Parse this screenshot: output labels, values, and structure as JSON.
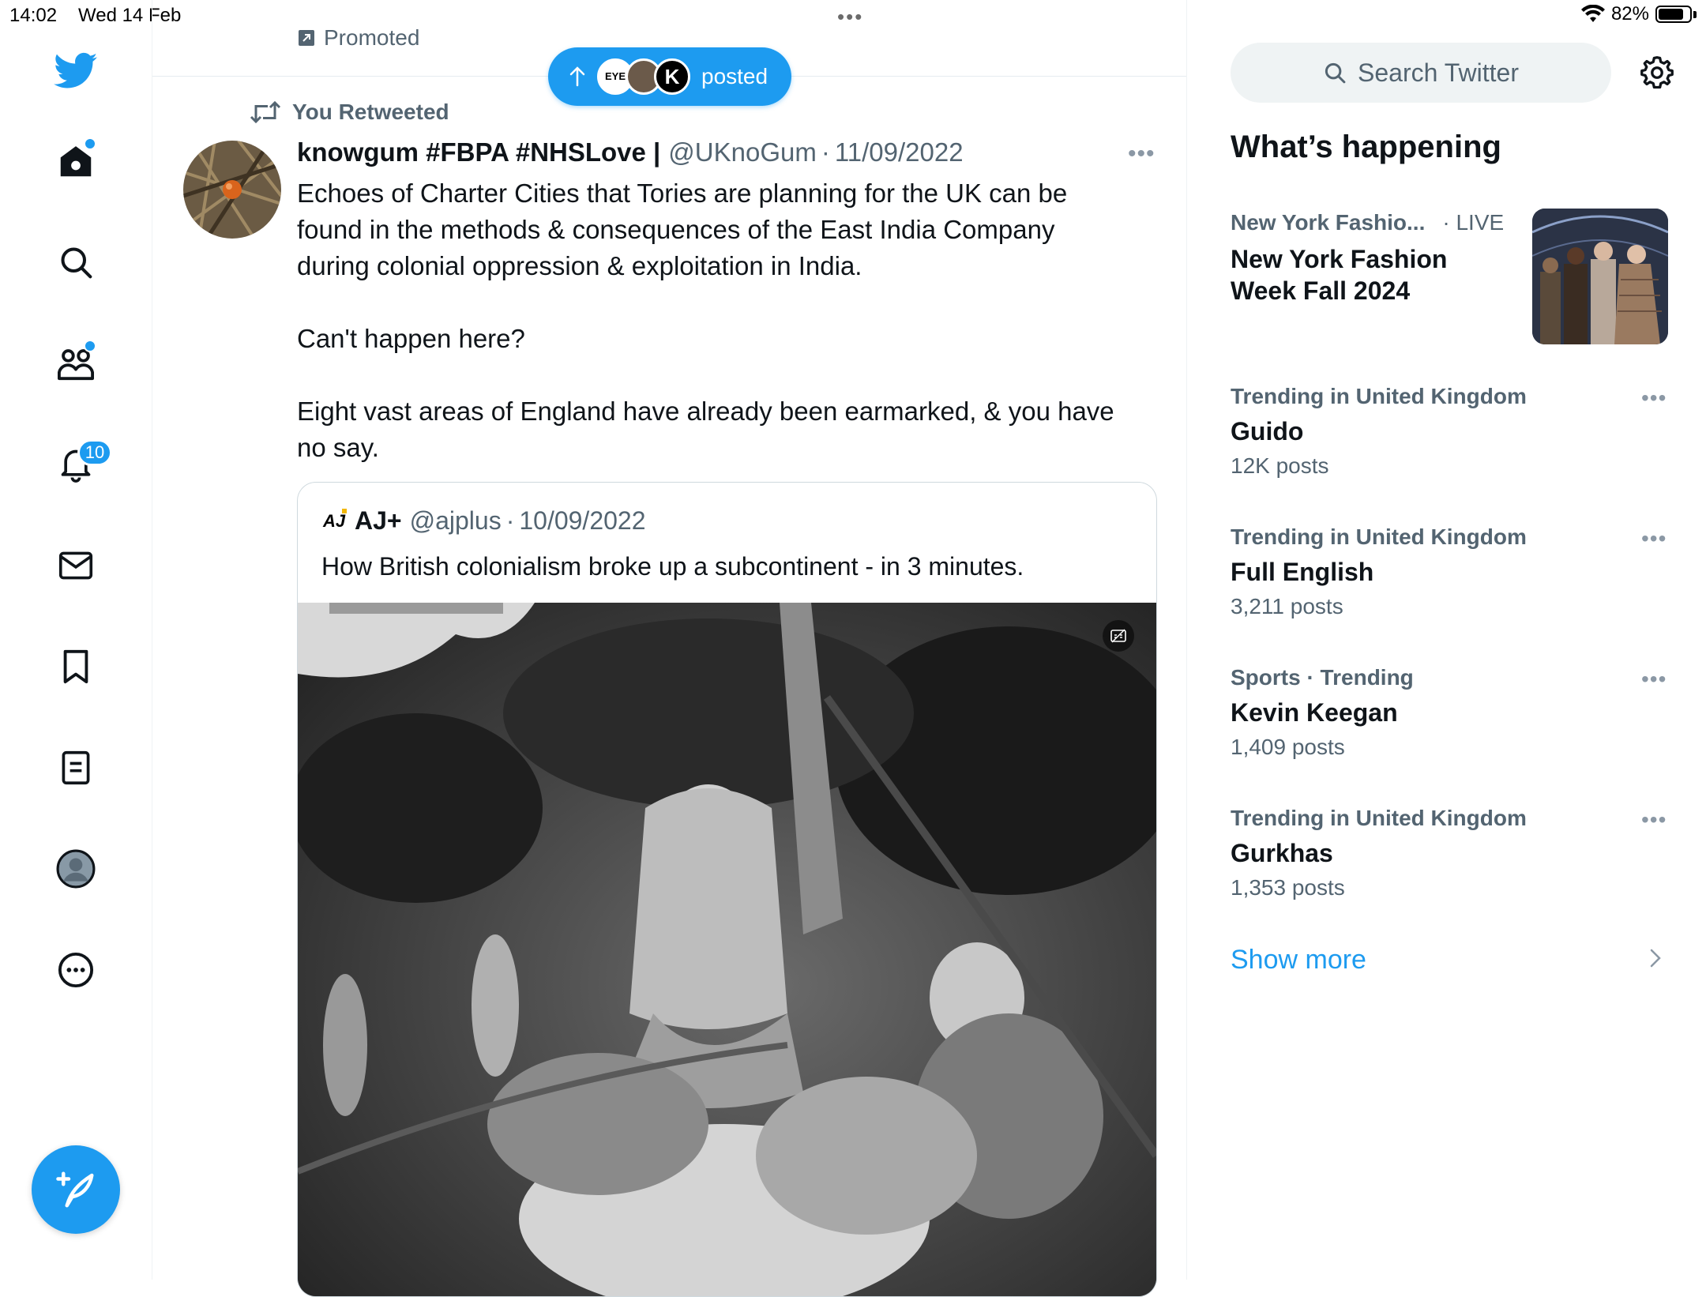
{
  "status_bar": {
    "time": "14:02",
    "date": "Wed 14 Feb",
    "battery": "82%",
    "battery_level": 0.82
  },
  "nav": {
    "items": [
      "home-icon",
      "explore-icon",
      "communities-icon",
      "notifications-icon",
      "messages-icon",
      "bookmarks-icon",
      "lists-icon",
      "profile-icon",
      "more-icon"
    ],
    "notifications_badge": "10",
    "compose_label": "compose-icon"
  },
  "timeline": {
    "promoted_label": "Promoted",
    "new_posts_pill": {
      "label": "posted",
      "avatar_text": [
        "EYE",
        "K"
      ]
    },
    "retweet_context": "You Retweeted",
    "tweet": {
      "name": "knowgum #FBPA #NHSLove |",
      "handle": "@UKnoGum",
      "separator": "·",
      "date": "11/09/2022",
      "text": "Echoes of Charter Cities that Tories are planning for the UK can be\nfound in the methods & consequences of the East India Company\nduring colonial oppression & exploitation in India.\n\nCan't happen here?\n\nEight vast areas of England have already been earmarked, & you have\nno say.",
      "quote": {
        "logo": "AJ",
        "name": "AJ+",
        "handle": "@ajplus",
        "separator": "·",
        "date": "10/09/2022",
        "text": "How British colonialism broke up a subcontinent - in 3 minutes."
      }
    }
  },
  "sidebar": {
    "search_placeholder": "Search Twitter",
    "section_title": "What’s happening",
    "featured": {
      "context": "New York Fashio...",
      "live": "· LIVE",
      "title_line1": "New York Fashion",
      "title_line2": "Week Fall 2024"
    },
    "trends": [
      {
        "context": "Trending in United Kingdom",
        "title": "Guido",
        "count": "12K posts"
      },
      {
        "context": "Trending in United Kingdom",
        "title": "Full English",
        "count": "3,211 posts"
      },
      {
        "context": "Sports · Trending",
        "title": "Kevin Keegan",
        "count": "1,409 posts"
      },
      {
        "context": "Trending in United Kingdom",
        "title": "Gurkhas",
        "count": "1,353 posts"
      }
    ],
    "more_dots": "•••",
    "show_more": "Show more"
  },
  "colors": {
    "accent": "#1d9bf0",
    "text": "#0f1419",
    "secondary": "#536471",
    "border": "#eff3f4"
  }
}
